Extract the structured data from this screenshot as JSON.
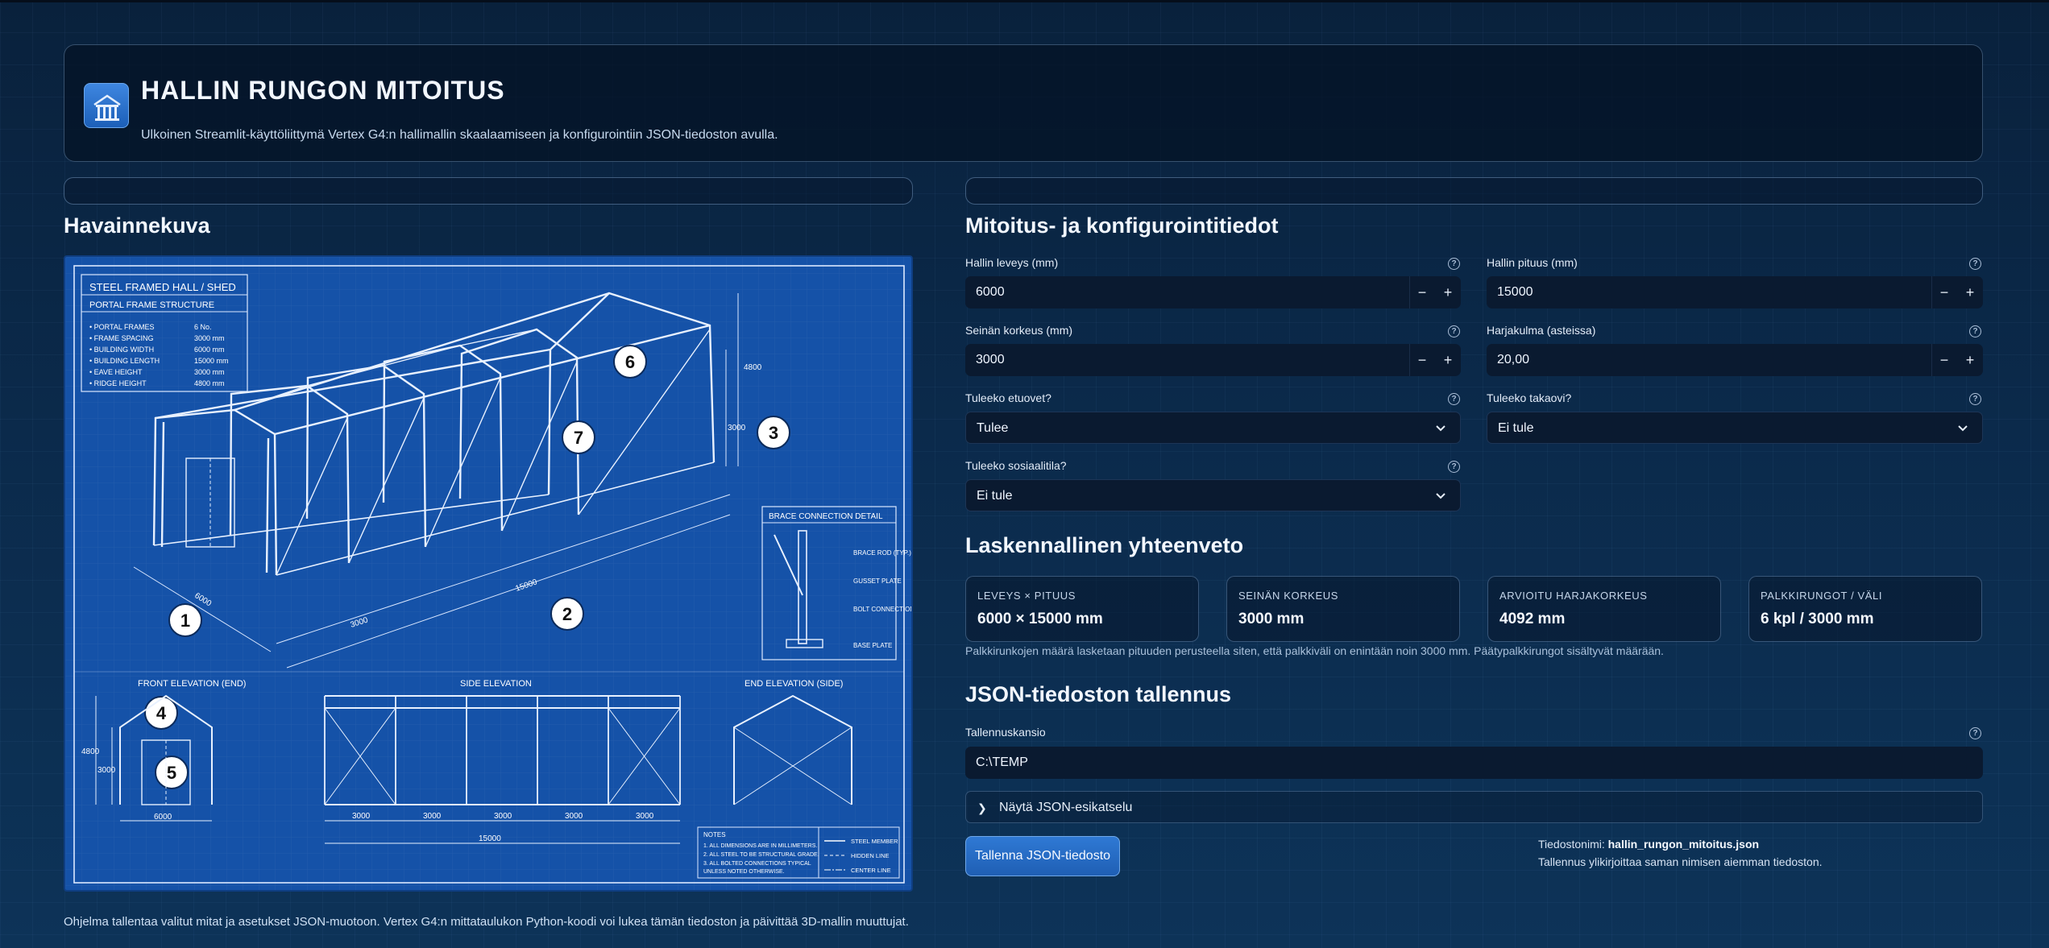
{
  "header": {
    "title": "HALLIN RUNGON MITOITUS",
    "subtitle": "Ulkoinen Streamlit-käyttöliittymä Vertex G4:n hallimallin skaalaamiseen ja konfigurointiin JSON-tiedoston avulla.",
    "logo_icon": "building-icon"
  },
  "left": {
    "section_title": "Havainnekuva",
    "footer_note": "Ohjelma tallentaa valitut mitat ja asetukset JSON-muotoon. Vertex G4:n mittataulukon Python-koodi voi lukea tämän tiedoston ja päivittää 3D-mallin muuttujat."
  },
  "blueprint": {
    "spec_title": "STEEL FRAMED HALL / SHED",
    "spec_subtitle": "PORTAL FRAME STRUCTURE",
    "specs": [
      {
        "label": "• PORTAL FRAMES",
        "value": "6 No."
      },
      {
        "label": "• FRAME SPACING",
        "value": "3000 mm"
      },
      {
        "label": "• BUILDING WIDTH",
        "value": "6000 mm"
      },
      {
        "label": "• BUILDING LENGTH",
        "value": "15000 mm"
      },
      {
        "label": "• EAVE HEIGHT",
        "value": "3000 mm"
      },
      {
        "label": "• RIDGE HEIGHT",
        "value": "4800 mm"
      }
    ],
    "callouts": [
      "1",
      "2",
      "3",
      "4",
      "5",
      "6",
      "7"
    ],
    "dims": {
      "iso_width": "6000",
      "iso_length": "15000",
      "iso_spacing": "3000",
      "iso_ridge": "4800",
      "iso_eave": "3000"
    },
    "brace_title": "BRACE CONNECTION DETAIL",
    "brace_labels": [
      "BRACE ROD (TYP.)",
      "GUSSET PLATE",
      "BOLT CONNECTION",
      "BASE PLATE"
    ],
    "front_title": "FRONT ELEVATION (END)",
    "side_title": "SIDE ELEVATION",
    "end_title": "END ELEVATION (SIDE)",
    "front_dims": {
      "ridge": "4800",
      "eave": "3000",
      "width": "6000"
    },
    "side_dims": {
      "spacing": "3000",
      "total": "15000"
    },
    "notes_title": "NOTES",
    "notes": [
      "1.  ALL DIMENSIONS ARE IN MILLIMETERS.",
      "2.  ALL STEEL TO BE STRUCTURAL GRADE.",
      "3.  ALL BOLTED CONNECTIONS TYPICAL",
      "     UNLESS NOTED OTHERWISE."
    ],
    "legend": [
      "STEEL MEMBER",
      "HIDDEN LINE",
      "CENTER LINE"
    ]
  },
  "right": {
    "section_title": "Mitoitus- ja konfigurointitiedot",
    "fields": {
      "width": {
        "label": "Hallin leveys (mm)",
        "value": "6000"
      },
      "length": {
        "label": "Hallin pituus (mm)",
        "value": "15000"
      },
      "wall_height": {
        "label": "Seinän korkeus (mm)",
        "value": "3000"
      },
      "roof_angle": {
        "label": "Harjakulma (asteissa)",
        "value": "20,00"
      },
      "front_door": {
        "label": "Tuleeko etuovet?",
        "value": "Tulee"
      },
      "back_door": {
        "label": "Tuleeko takaovi?",
        "value": "Ei tule"
      },
      "social": {
        "label": "Tuleeko sosiaalitila?",
        "value": "Ei tule"
      }
    },
    "stepper_minus": "−",
    "stepper_plus": "+",
    "help_glyph": "?"
  },
  "summary": {
    "title": "Laskennallinen yhteenveto",
    "metrics": [
      {
        "label": "LEVEYS × PITUUS",
        "value": "6000 × 15000 mm"
      },
      {
        "label": "SEINÄN KORKEUS",
        "value": "3000 mm"
      },
      {
        "label": "ARVIOITU HARJAKORKEUS",
        "value": "4092 mm"
      },
      {
        "label": "PALKKIRUNGOT / VÄLI",
        "value": "6 kpl / 3000 mm"
      }
    ],
    "note": "Palkkirunkojen määrä lasketaan pituuden perusteella siten, että palkkiväli on enintään noin 3000 mm. Päätypalkkirungot sisältyvät määrään."
  },
  "json_save": {
    "title": "JSON-tiedoston tallennus",
    "folder_label": "Tallennuskansio",
    "folder_value": "C:\\TEMP",
    "expander_label": "Näytä JSON-esikatselu",
    "save_button": "Tallenna JSON-tiedosto",
    "filename_prefix": "Tiedostonimi: ",
    "filename": "hallin_rungon_mitoitus.json",
    "overwrite_note": "Tallennus ylikirjoittaa saman nimisen aiemman tiedoston."
  },
  "colors": {
    "blueprint_bg": "#1552a8",
    "primary_button": "#2f79d4",
    "background": "#0b2a4b"
  }
}
